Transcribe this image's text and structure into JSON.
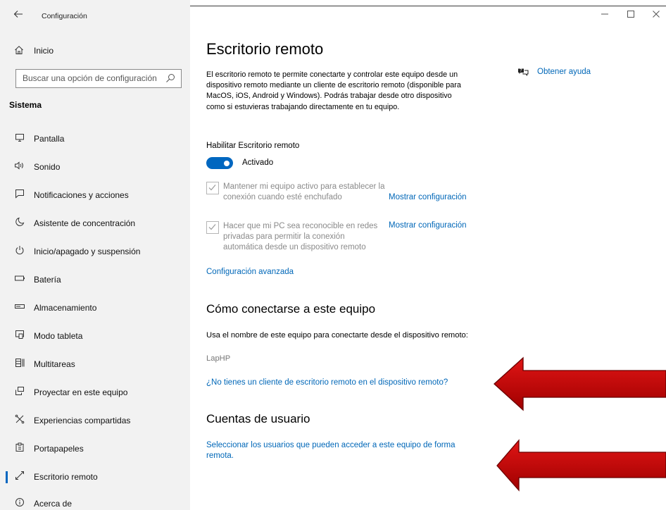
{
  "window": {
    "app_title": "Configuración",
    "back_icon": "arrow-left-icon",
    "controls": {
      "minimize": "—",
      "maximize": "☐",
      "close": "✕"
    }
  },
  "sidebar": {
    "home_label": "Inicio",
    "search_placeholder": "Buscar una opción de configuración",
    "section_label": "Sistema",
    "items": [
      {
        "label": "Pantalla",
        "icon": "monitor-icon",
        "glyph": "🖵"
      },
      {
        "label": "Sonido",
        "icon": "speaker-icon",
        "glyph": "🕪"
      },
      {
        "label": "Notificaciones y acciones",
        "icon": "notification-icon",
        "glyph": "🗨"
      },
      {
        "label": "Asistente de concentración",
        "icon": "moon-icon",
        "glyph": "☽"
      },
      {
        "label": "Inicio/apagado y suspensión",
        "icon": "power-icon",
        "glyph": "⏻"
      },
      {
        "label": "Batería",
        "icon": "battery-icon",
        "glyph": "▭"
      },
      {
        "label": "Almacenamiento",
        "icon": "storage-icon",
        "glyph": "▭"
      },
      {
        "label": "Modo tableta",
        "icon": "tablet-icon",
        "glyph": "⧉"
      },
      {
        "label": "Multitareas",
        "icon": "multitask-icon",
        "glyph": "⊟"
      },
      {
        "label": "Proyectar en este equipo",
        "icon": "project-icon",
        "glyph": "⎚"
      },
      {
        "label": "Experiencias compartidas",
        "icon": "shared-icon",
        "glyph": "✕"
      },
      {
        "label": "Portapapeles",
        "icon": "clipboard-icon",
        "glyph": "📋"
      },
      {
        "label": "Escritorio remoto",
        "icon": "remote-desktop-icon",
        "glyph": "⤡",
        "selected": true
      },
      {
        "label": "Acerca de",
        "icon": "info-icon",
        "glyph": "ⓘ"
      }
    ]
  },
  "main": {
    "title": "Escritorio remoto",
    "description": "El escritorio remoto te permite conectarte y controlar este equipo desde un dispositivo remoto mediante un cliente de escritorio remoto (disponible para MacOS, iOS, Android y Windows). Podrás trabajar desde otro dispositivo como si estuvieras trabajando directamente en tu equipo.",
    "help_link": "Obtener ayuda",
    "enable_label": "Habilitar Escritorio remoto",
    "toggle_state": "Activado",
    "toggle_on": true,
    "option1_text": "Mantener mi equipo activo para establecer la conexión cuando esté enchufado",
    "option1_link": "Mostrar configuración",
    "option2_text": "Hacer que mi PC sea reconocible en redes privadas para permitir la conexión automática desde un dispositivo remoto",
    "option2_link": "Mostrar configuración",
    "advanced_link": "Configuración avanzada",
    "connect_title": "Cómo conectarse a este equipo",
    "connect_text": "Usa el nombre de este equipo para conectarte desde el dispositivo remoto:",
    "pc_name": "LapHP",
    "no_client_link": "¿No tienes un cliente de escritorio remoto en el dispositivo remoto?",
    "accounts_title": "Cuentas de usuario",
    "accounts_link": "Seleccionar los usuarios que pueden acceder a este equipo de forma remota."
  },
  "colors": {
    "accent": "#0067c0",
    "link": "#0067b8",
    "sidebar_bg": "#f2f2f2",
    "annotation_arrow": "#c00000"
  }
}
